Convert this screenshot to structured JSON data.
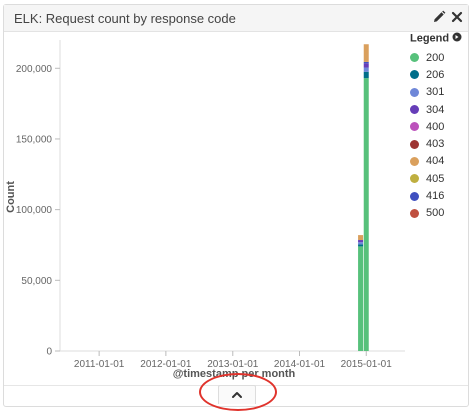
{
  "panel": {
    "title": "ELK: Request count by response code",
    "edit_icon": "pencil-icon",
    "close_icon": "close-icon"
  },
  "legend": {
    "title": "Legend",
    "title_icon": "refresh-icon",
    "items": [
      {
        "label": "200",
        "color": "#57c17b"
      },
      {
        "label": "206",
        "color": "#006e8a"
      },
      {
        "label": "301",
        "color": "#6f87d8"
      },
      {
        "label": "304",
        "color": "#663db8"
      },
      {
        "label": "400",
        "color": "#bc52bc"
      },
      {
        "label": "403",
        "color": "#9e3533"
      },
      {
        "label": "404",
        "color": "#daa05d"
      },
      {
        "label": "405",
        "color": "#bfaf40"
      },
      {
        "label": "416",
        "color": "#4050bf"
      },
      {
        "label": "500",
        "color": "#bf5040"
      }
    ]
  },
  "collapse": {
    "icon": "chevron-up-icon"
  },
  "chart_data": {
    "type": "bar",
    "stacked": true,
    "title": "",
    "xlabel": "@timestamp per month",
    "ylabel": "Count",
    "ylim": [
      0,
      220000
    ],
    "y_ticks": [
      0,
      50000,
      100000,
      150000,
      200000
    ],
    "y_tick_labels": [
      "0",
      "50,000",
      "100,000",
      "150,000",
      "200,000"
    ],
    "x_tick_labels": [
      "2011-01-01",
      "2012-01-01",
      "2013-01-01",
      "2014-01-01",
      "2015-01-01"
    ],
    "x_tick_dates": [
      "2011-01-01",
      "2012-01-01",
      "2013-01-01",
      "2014-01-01",
      "2015-01-01"
    ],
    "x_range": [
      "2010-06-01",
      "2015-08-01"
    ],
    "grid": false,
    "legend_position": "right",
    "bars": [
      {
        "date": "2014-12-01",
        "segments": [
          {
            "series": "200",
            "value": 74000
          },
          {
            "series": "206",
            "value": 1500
          },
          {
            "series": "301",
            "value": 1500
          },
          {
            "series": "304",
            "value": 1500
          },
          {
            "series": "404",
            "value": 3500
          }
        ]
      },
      {
        "date": "2015-01-01",
        "segments": [
          {
            "series": "200",
            "value": 193000
          },
          {
            "series": "206",
            "value": 4500
          },
          {
            "series": "301",
            "value": 3000
          },
          {
            "series": "304",
            "value": 3000
          },
          {
            "series": "416",
            "value": 1000
          },
          {
            "series": "404",
            "value": 12500
          }
        ]
      }
    ]
  }
}
